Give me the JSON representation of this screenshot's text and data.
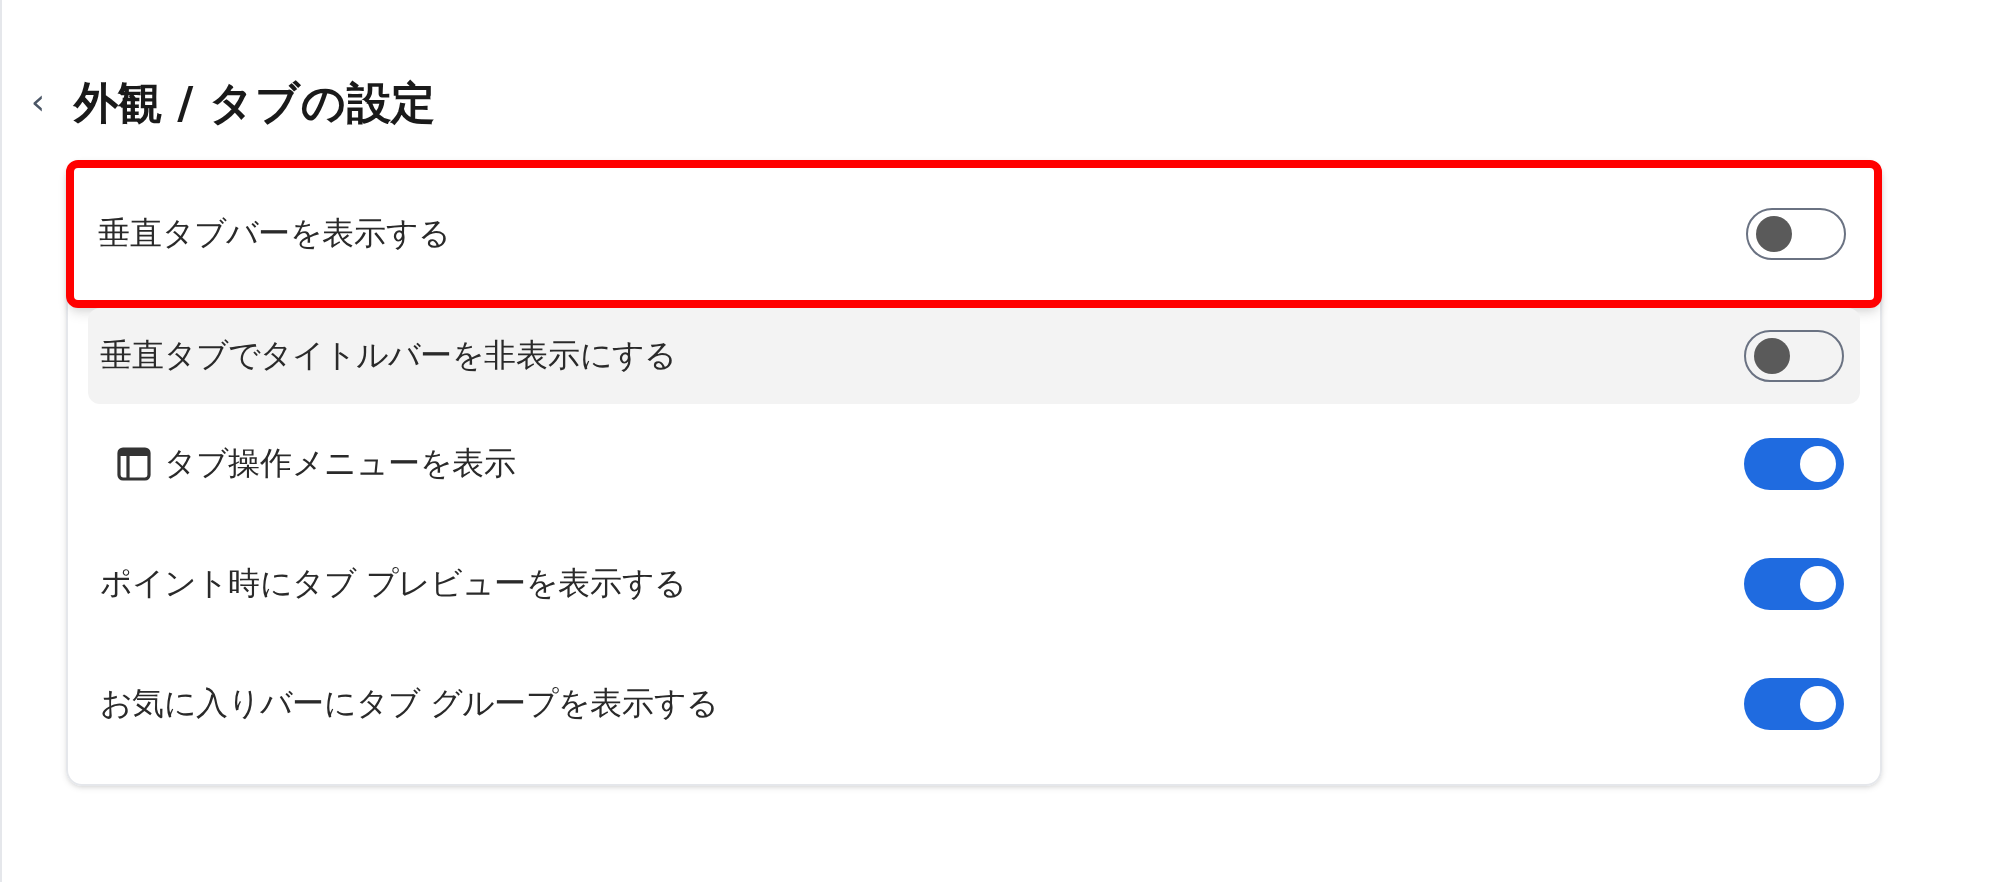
{
  "header": {
    "back": "‹",
    "title": "外観 / タブの設定"
  },
  "settings": [
    {
      "label": "垂直タブバーを表示する",
      "on": false,
      "highlighted": true,
      "hovered": false
    },
    {
      "label": "垂直タブでタイトルバーを非表示にする",
      "on": false,
      "highlighted": false,
      "hovered": true
    },
    {
      "label": "タブ操作メニューを表示",
      "on": true,
      "highlighted": false,
      "hovered": false,
      "kind": "icon"
    },
    {
      "label": "ポイント時にタブ プレビューを表示する",
      "on": true,
      "highlighted": false,
      "hovered": false
    },
    {
      "label": "お気に入りバーにタブ グループを表示する",
      "on": true,
      "highlighted": false,
      "hovered": false
    }
  ]
}
